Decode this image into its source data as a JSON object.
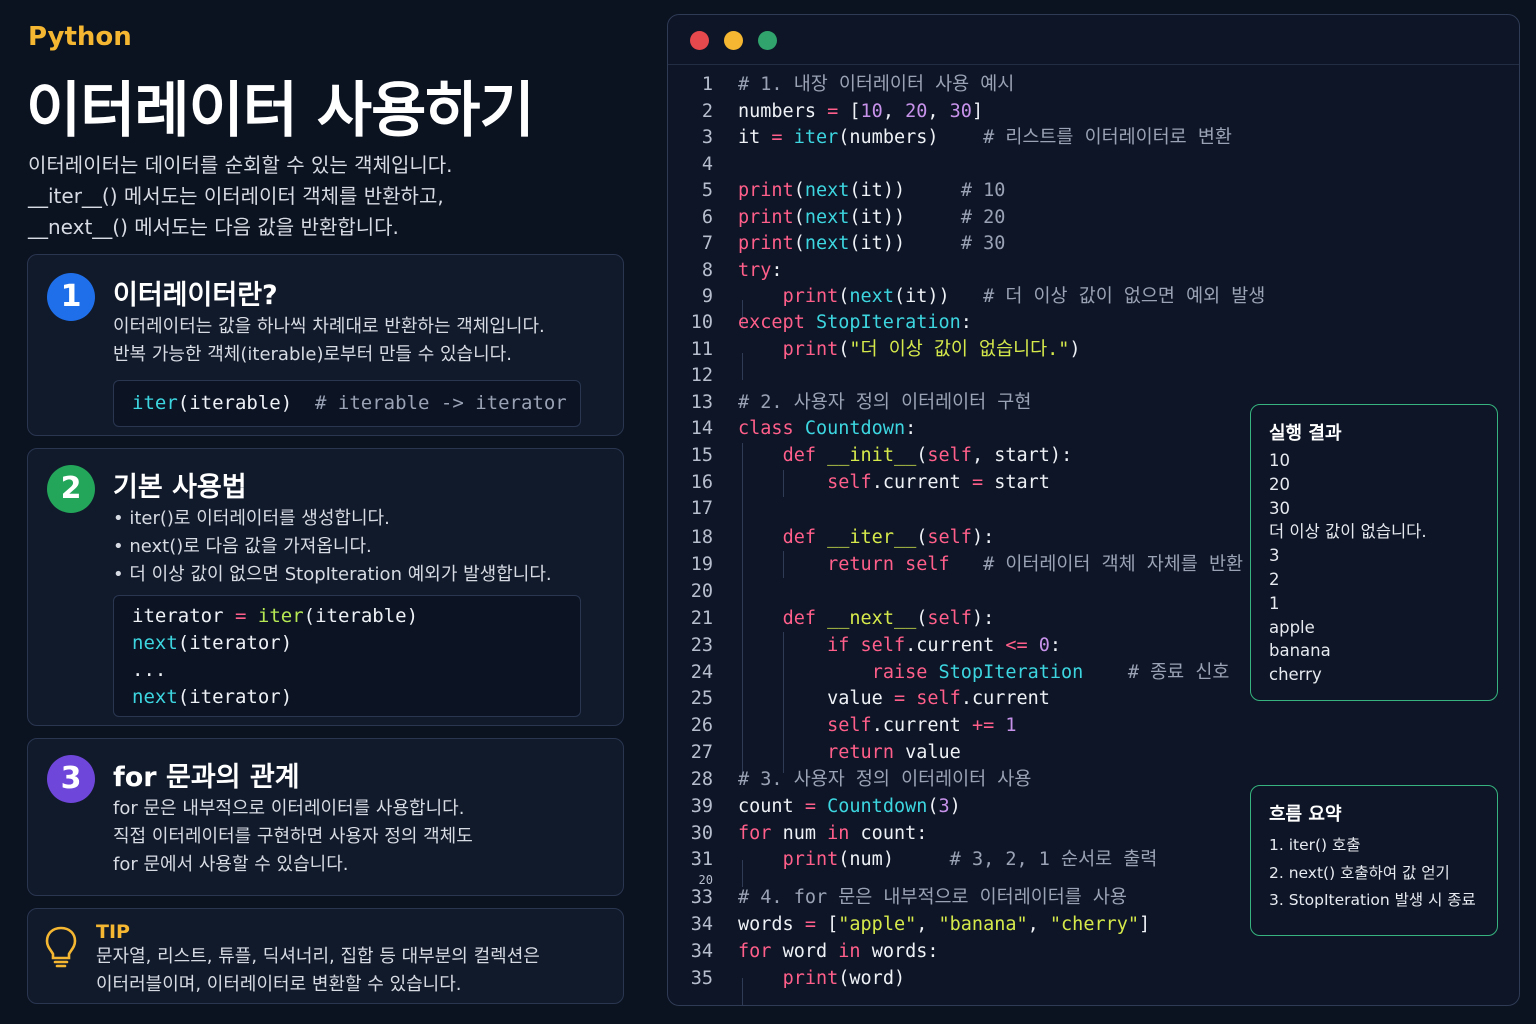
{
  "header": {
    "language": "Python",
    "title": "이터레이터 사용하기",
    "intro": [
      "이터레이터는 데이터를 순회할 수 있는 객체입니다.",
      "__iter__() 메서도는 이터레이터 객체를 반환하고,",
      "__next__() 메서도는 다음 값을 반환합니다."
    ]
  },
  "cards": [
    {
      "number": "1",
      "title": "이터레이터란?",
      "desc": [
        "이터레이터는 값을 하나씩 차례대로 반환하는 객체입니다.",
        "반복 가능한 객체(iterable)로부터 만들 수 있습니다."
      ],
      "code": [
        "iter(iterable)  # iterable -> iterator"
      ]
    },
    {
      "number": "2",
      "title": "기본 사용법",
      "desc": [
        "• iter()로 이터레이터를 생성합니다.",
        "• next()로 다음 값을 가져옵니다.",
        "• 더 이상 값이 없으면 StopIteration 예외가 발생합니다."
      ],
      "code": [
        "iterator = iter(iterable)",
        "next(iterator)",
        "...",
        "next(iterator)"
      ]
    },
    {
      "number": "3",
      "title": "for 문과의 관계",
      "desc": [
        "for 문은 내부적으로 이터레이터를 사용합니다.",
        "직접 이터레이터를 구현하면 사용자 정의 객체도",
        "for 문에서 사용할 수 있습니다."
      ]
    }
  ],
  "tip": {
    "label": "TIP",
    "text": [
      "문자열, 리스트, 튜플, 딕셔너리, 집합 등 대부분의 컬렉션은",
      "이터러블이며, 이터레이터로 변환할 수 있습니다."
    ],
    "icon": "lightbulb-icon"
  },
  "editor": {
    "window_dots": [
      "#e5484d",
      "#f5b731",
      "#30a46c"
    ],
    "line_numbers": [
      "1",
      "2",
      "3",
      "4",
      "5",
      "6",
      "7",
      "8",
      "9",
      "10",
      "11",
      "12",
      "13",
      "14",
      "15",
      "16",
      "17",
      "18",
      "19",
      "20",
      "21",
      "23",
      "24",
      "25",
      "26",
      "27",
      "28",
      "39",
      "30",
      "31",
      "20",
      "33",
      "34",
      "34",
      "35"
    ],
    "code_lines": [
      "# 1. 내장 이터레이터 사용 예시",
      "numbers = [10, 20, 30]",
      "it = iter(numbers)    # 리스트를 이터레이터로 변환",
      "",
      "print(next(it))     # 10",
      "print(next(it))     # 20",
      "print(next(it))     # 30",
      "try:",
      "    print(next(it))   # 더 이상 값이 없으면 예외 발생",
      "except StopIteration:",
      "    print(\"더 이상 값이 없습니다.\")",
      "",
      "# 2. 사용자 정의 이터레이터 구현",
      "class Countdown:",
      "    def __init__(self, start):",
      "        self.current = start",
      "",
      "    def __iter__(self):",
      "        return self   # 이터레이터 객체 자체를 반환",
      "",
      "    def __next__(self):",
      "        if self.current <= 0:",
      "            raise StopIteration    # 종료 신호",
      "        value = self.current",
      "        self.current += 1",
      "        return value",
      "# 3. 사용자 정의 이터레이터 사용",
      "count = Countdown(3)",
      "for num in count:",
      "    print(num)     # 3, 2, 1 순서로 출력",
      "",
      "# 4. for 문은 내부적으로 이터레이터를 사용",
      "words = [\"apple\", \"banana\", \"cherry\"]",
      "for word in words:",
      "    print(word)"
    ]
  },
  "output_panel": {
    "title": "실행 결과",
    "lines": [
      "10",
      "20",
      "30",
      "더 이상 값이 없습니다.",
      "3",
      "2",
      "1",
      "apple",
      "banana",
      "cherry"
    ]
  },
  "flow_panel": {
    "title": "흐름 요약",
    "lines": [
      "1. iter() 호출",
      "2. next() 호출하여 값 얻기",
      "3. StopIteration 발생 시 종료"
    ]
  },
  "colors": {
    "accent": "#f5b731",
    "badge1": "#1f6feb",
    "badge2": "#23a55a",
    "badge3": "#6e46d9",
    "panel_border": "#36b37e"
  }
}
